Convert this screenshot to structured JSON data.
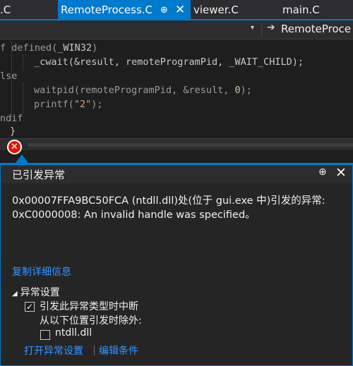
{
  "tabs": [
    {
      "label": ".C"
    },
    {
      "label": "RemoteProcess.C",
      "active": true,
      "pin": "⊕",
      "close": "✕"
    },
    {
      "label": "viewer.C"
    },
    {
      "label": "main.C"
    }
  ],
  "nav": {
    "dropdown_glyph": "▾",
    "arrow_glyph": "➔",
    "member_label": "RemoteProce"
  },
  "code": {
    "line1": {
      "kw": "f defined(",
      "macro": "_WIN32",
      "rest": ")"
    },
    "line2": {
      "fn": "_cwait(&result, remoteProgramPid, ",
      "macro": "_WAIT_CHILD",
      "rest": ");"
    },
    "line3": {
      "kw": "lse"
    },
    "line4": {
      "pre": "waitpid(remoteProgramPid, &result, ",
      "num": "0",
      "rest": ");"
    },
    "line5": {
      "pre": "printf(",
      "str": "\"2\"",
      "rest": ");"
    },
    "line6": {
      "kw": "ndif"
    },
    "line7": {
      "text": "}"
    }
  },
  "error_icon": "✕",
  "exception": {
    "title": "已引发异常",
    "pin_glyph": "⊕",
    "close_glyph": "✕",
    "message_line1": "0x00007FFA9BC50FCA (ntdll.dll)处(位于 gui.exe 中)引发的异常:",
    "message_line2": "0xC0000008: An invalid handle was specified。",
    "copy_details": "复制详细信息",
    "settings_section": "异常设置",
    "section_toggle": "◢",
    "break_on_type": "引发此异常类型时中断",
    "break_on_type_checked": true,
    "except_from": "从以下位置引发时除外:",
    "except_module": "ntdll.dll",
    "except_module_checked": false,
    "check_glyph": "✓",
    "open_settings": "打开异常设置",
    "edit_conditions": "编辑条件"
  }
}
